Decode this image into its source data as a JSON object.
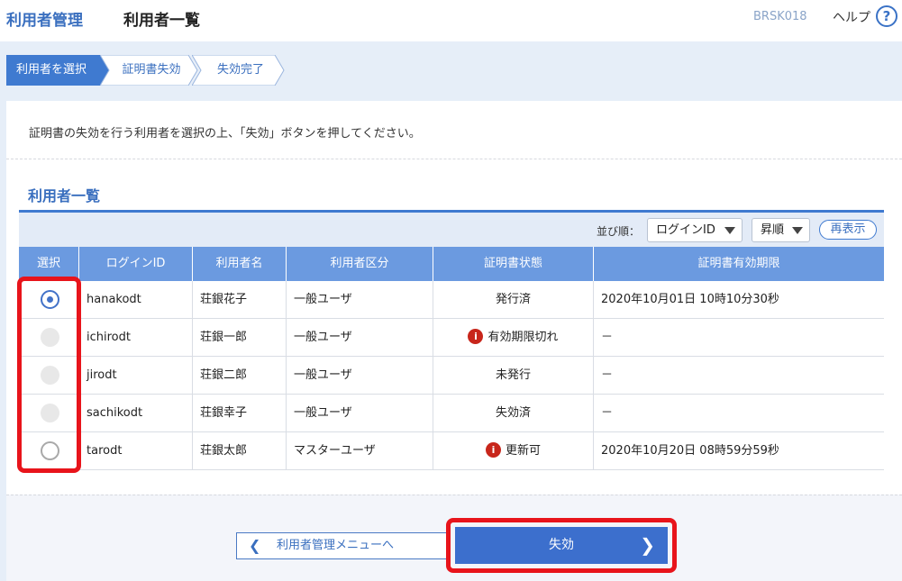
{
  "header": {
    "brand": "利用者管理",
    "title": "利用者一覧",
    "screen_id": "BRSK018",
    "help_label": "ヘルプ",
    "help_icon": "?"
  },
  "steps": [
    "利用者を選択",
    "証明書失効",
    "失効完了"
  ],
  "instruction": "証明書の失効を行う利用者を選択の上、「失効」ボタンを押してください。",
  "section_title": "利用者一覧",
  "toolbar": {
    "sort_label": "並び順：",
    "sort_field": "ログインID",
    "sort_order": "昇順",
    "refresh_label": "再表示"
  },
  "table": {
    "columns": [
      "選択",
      "ログインID",
      "利用者名",
      "利用者区分",
      "証明書状態",
      "証明書有効期限"
    ],
    "rows": [
      {
        "radio": "selected",
        "login_id": "hanakodt",
        "name": "荘銀花子",
        "type": "一般ユーザ",
        "status": "発行済",
        "warn": false,
        "expiry": "2020年10月01日 10時10分30秒"
      },
      {
        "radio": "disabled",
        "login_id": "ichirodt",
        "name": "荘銀一郎",
        "type": "一般ユーザ",
        "status": "有効期限切れ",
        "warn": true,
        "expiry": "－"
      },
      {
        "radio": "disabled",
        "login_id": "jirodt",
        "name": "荘銀二郎",
        "type": "一般ユーザ",
        "status": "未発行",
        "warn": false,
        "expiry": "－"
      },
      {
        "radio": "disabled",
        "login_id": "sachikodt",
        "name": "荘銀幸子",
        "type": "一般ユーザ",
        "status": "失効済",
        "warn": false,
        "expiry": "－"
      },
      {
        "radio": "empty",
        "login_id": "tarodt",
        "name": "荘銀太郎",
        "type": "マスターユーザ",
        "status": "更新可",
        "warn": true,
        "expiry": "2020年10月20日 08時59分59秒"
      }
    ]
  },
  "buttons": {
    "back_label": "利用者管理メニューへ",
    "revoke_label": "失効"
  },
  "colors": {
    "accent": "#3c6fcd",
    "header_blue": "#6b9ae0",
    "highlight_red": "#e8141b",
    "warning_red": "#c8261b"
  }
}
